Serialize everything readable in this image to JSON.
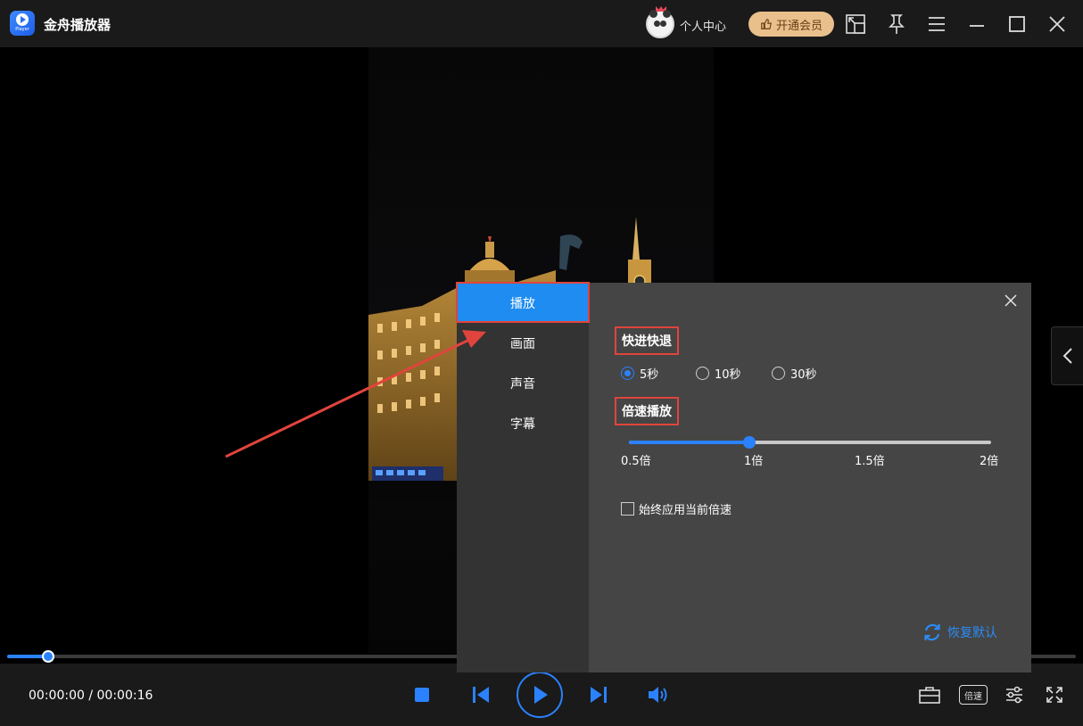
{
  "app": {
    "title": "金舟播放器",
    "logo_text": "Player"
  },
  "header": {
    "user_center": "个人中心",
    "vip_label": "开通会员"
  },
  "player": {
    "time_current": "00:00:00",
    "time_separator": " / ",
    "time_total": "00:00:16",
    "progress_fraction": 0.038,
    "speed_button_label": "倍速"
  },
  "settings": {
    "tabs": [
      {
        "label": "播放",
        "active": true
      },
      {
        "label": "画面",
        "active": false
      },
      {
        "label": "声音",
        "active": false
      },
      {
        "label": "字幕",
        "active": false
      }
    ],
    "seek_section": {
      "title": "快进快退",
      "options": [
        {
          "label": "5秒",
          "checked": true
        },
        {
          "label": "10秒",
          "checked": false
        },
        {
          "label": "30秒",
          "checked": false
        }
      ]
    },
    "speed_section": {
      "title": "倍速播放",
      "ticks": [
        "0.5倍",
        "1倍",
        "1.5倍",
        "2倍"
      ],
      "value": 1,
      "min": 0.5,
      "max": 2
    },
    "always_apply_label": "始终应用当前倍速",
    "always_apply_checked": false,
    "reset_label": "恢复默认"
  },
  "colors": {
    "accent": "#2b82ff",
    "annotation": "#e0443c",
    "vip": "#e9bf8c"
  }
}
